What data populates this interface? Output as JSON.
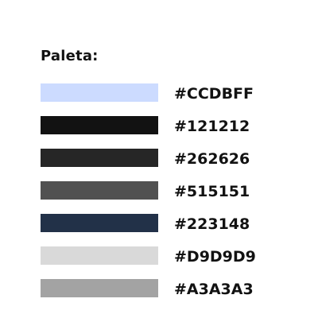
{
  "title": "Paleta:",
  "colors": [
    {
      "hex": "#CCDBFF",
      "label": "#CCDBFF"
    },
    {
      "hex": "#121212",
      "label": "#121212"
    },
    {
      "hex": "#262626",
      "label": "#262626"
    },
    {
      "hex": "#515151",
      "label": "#515151"
    },
    {
      "hex": "#223148",
      "label": "#223148"
    },
    {
      "hex": "#D9D9D9",
      "label": "#D9D9D9"
    },
    {
      "hex": "#A3A3A3",
      "label": "#A3A3A3"
    }
  ]
}
